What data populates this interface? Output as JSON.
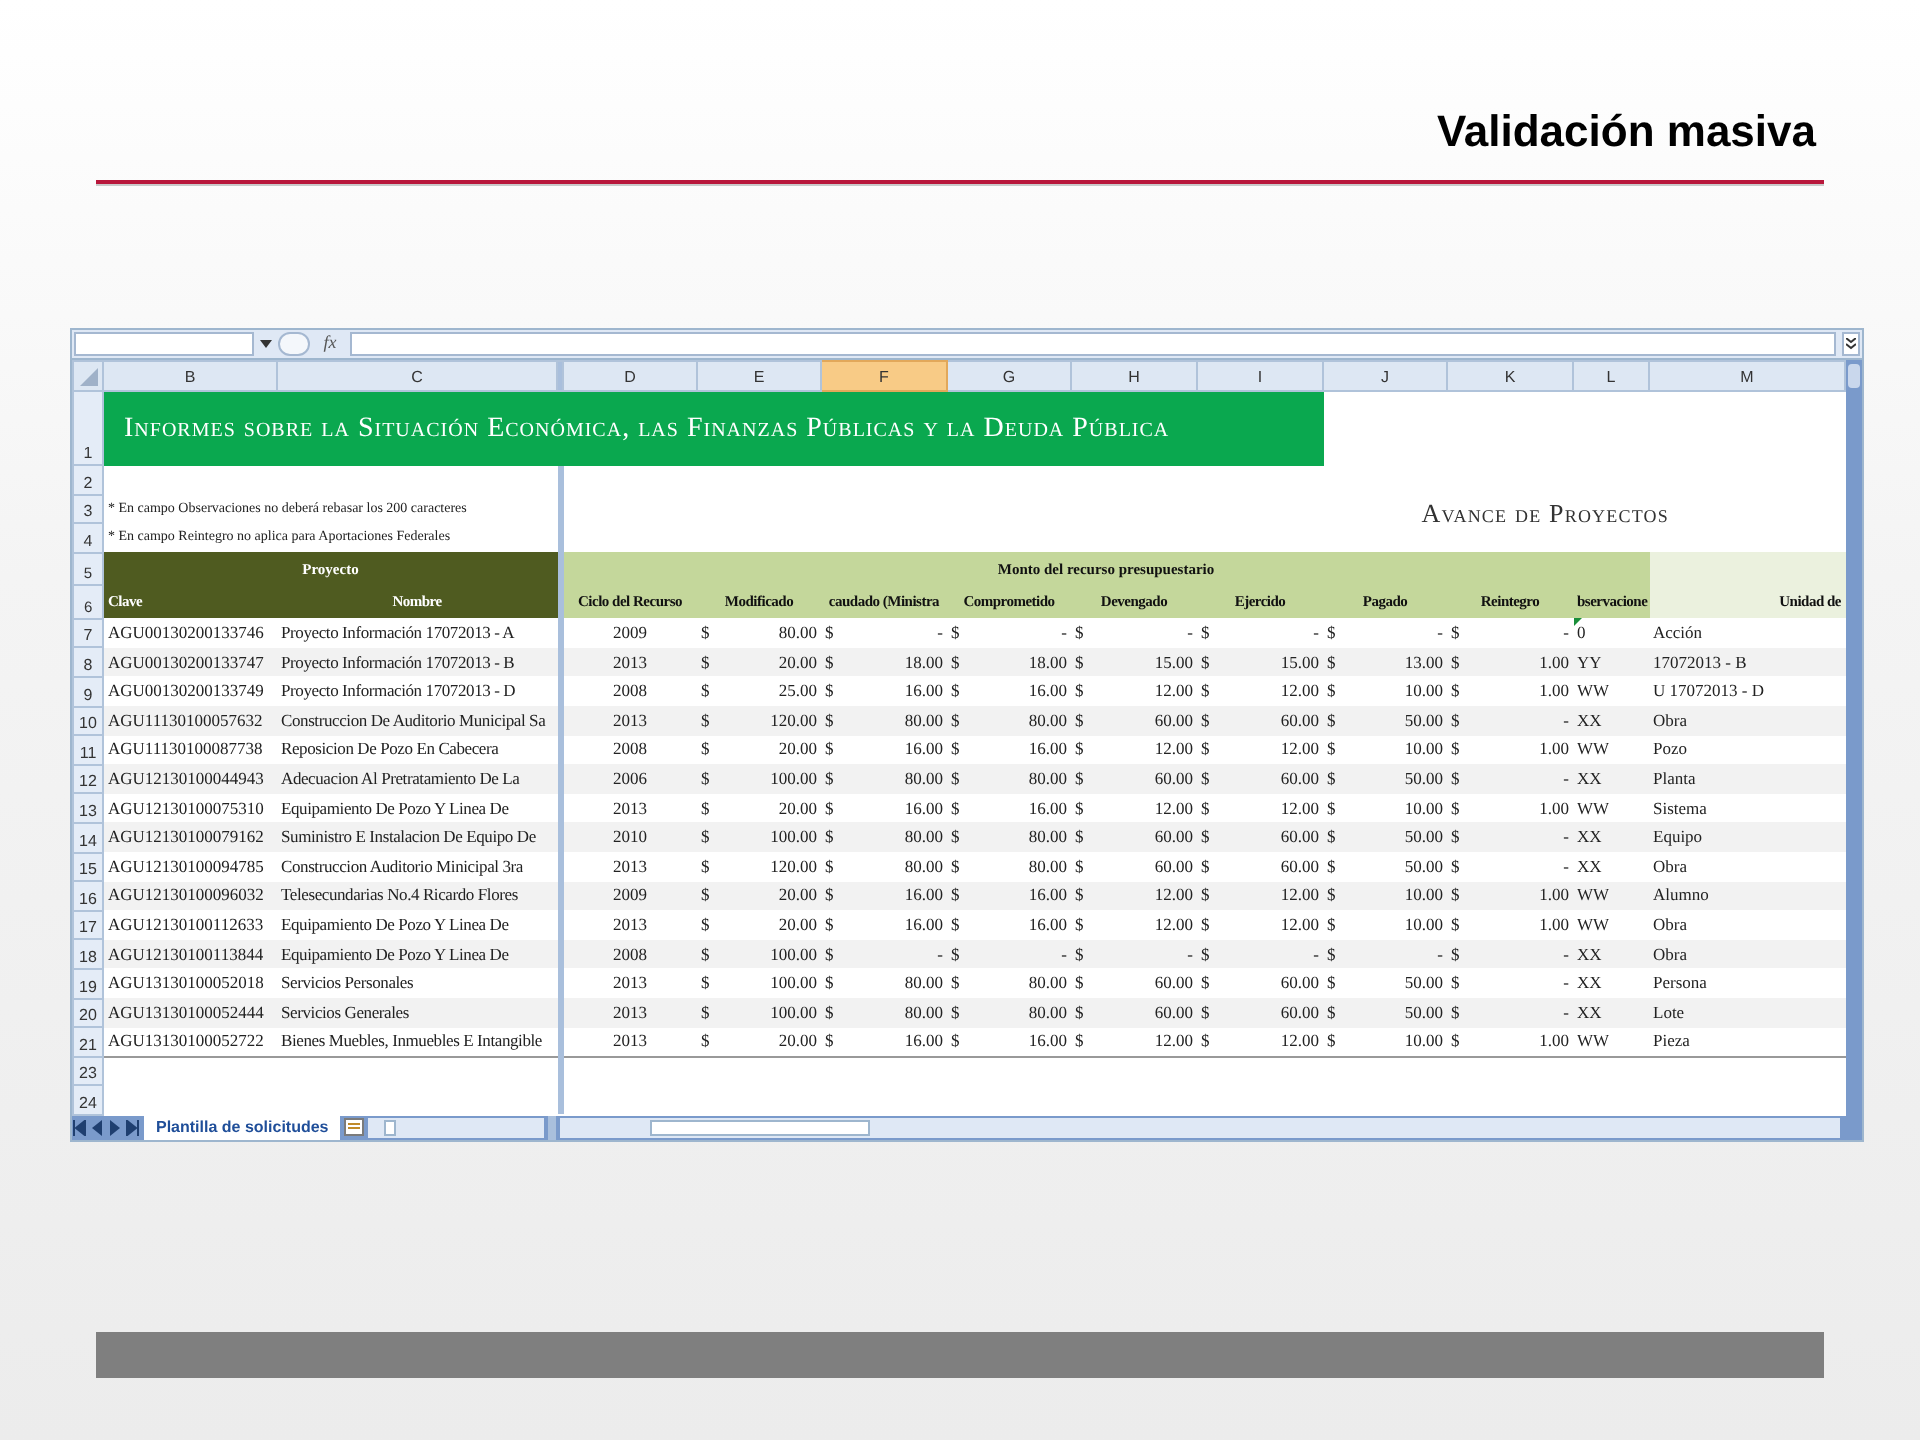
{
  "slide": {
    "title": "Validación masiva"
  },
  "spreadsheet": {
    "formula_bar": {
      "function_label": "fx"
    },
    "column_headers": [
      {
        "label": "B",
        "selected": false
      },
      {
        "label": "C",
        "selected": false
      },
      {
        "label": "D",
        "selected": false
      },
      {
        "label": "E",
        "selected": false
      },
      {
        "label": "F",
        "selected": true
      },
      {
        "label": "G",
        "selected": false
      },
      {
        "label": "H",
        "selected": false
      },
      {
        "label": "I",
        "selected": false
      },
      {
        "label": "J",
        "selected": false
      },
      {
        "label": "K",
        "selected": false
      },
      {
        "label": "L",
        "selected": false
      },
      {
        "label": "M",
        "selected": false
      }
    ],
    "row_numbers": [
      "1",
      "2",
      "3",
      "4",
      "5",
      "6",
      "7",
      "8",
      "9",
      "10",
      "11",
      "12",
      "13",
      "14",
      "15",
      "16",
      "17",
      "18",
      "19",
      "20",
      "21",
      "23",
      "24"
    ],
    "banner": "Informes sobre la Situación Económica, las Finanzas Públicas y la Deuda Pública",
    "subtitle": "Avance de Proyectos",
    "notes": [
      "* En campo Observaciones no deberá rebasar los 200 caracteres",
      "* En campo Reintegro no aplica para Aportaciones Federales"
    ],
    "column_groups": [
      {
        "kind": "project",
        "label": "Proyecto",
        "columns": [
          "Clave",
          "Nombre"
        ]
      },
      {
        "kind": "budget",
        "label": "Monto del recurso presupuestario",
        "columns": [
          "Ciclo del Recurso",
          "Modificado",
          "caudado (Ministra",
          "Comprometido",
          "Devengado",
          "Ejercido",
          "Pagado",
          "Reintegro",
          "bservacione"
        ]
      },
      {
        "kind": "extra",
        "columns": [
          "Unidad de"
        ]
      }
    ],
    "rows": [
      {
        "clave": "AGU00130200133746",
        "nombre": "Proyecto Información 17072013 - A",
        "ciclo": "2009",
        "amounts": [
          [
            "$",
            "80.00"
          ],
          [
            "$",
            "-"
          ],
          [
            "$",
            "-"
          ],
          [
            "$",
            "-"
          ],
          [
            "$",
            "-"
          ],
          [
            "$",
            "-"
          ],
          [
            "$",
            "-"
          ]
        ],
        "observaciones": "0",
        "unidad": "Acción",
        "flagged": true
      },
      {
        "clave": "AGU00130200133747",
        "nombre": "Proyecto Información 17072013 - B",
        "ciclo": "2013",
        "amounts": [
          [
            "$",
            "20.00"
          ],
          [
            "$",
            "18.00"
          ],
          [
            "$",
            "18.00"
          ],
          [
            "$",
            "15.00"
          ],
          [
            "$",
            "15.00"
          ],
          [
            "$",
            "13.00"
          ],
          [
            "$",
            "1.00"
          ]
        ],
        "observaciones": "YY",
        "unidad": "17072013 - B",
        "flagged": false
      },
      {
        "clave": "AGU00130200133749",
        "nombre": "Proyecto Información 17072013 - D",
        "ciclo": "2008",
        "amounts": [
          [
            "$",
            "25.00"
          ],
          [
            "$",
            "16.00"
          ],
          [
            "$",
            "16.00"
          ],
          [
            "$",
            "12.00"
          ],
          [
            "$",
            "12.00"
          ],
          [
            "$",
            "10.00"
          ],
          [
            "$",
            "1.00"
          ]
        ],
        "observaciones": "WW",
        "unidad": "U 17072013 - D",
        "flagged": false
      },
      {
        "clave": "AGU11130100057632",
        "nombre": "Construccion De Auditorio Municipal Sa",
        "ciclo": "2013",
        "amounts": [
          [
            "$",
            "120.00"
          ],
          [
            "$",
            "80.00"
          ],
          [
            "$",
            "80.00"
          ],
          [
            "$",
            "60.00"
          ],
          [
            "$",
            "60.00"
          ],
          [
            "$",
            "50.00"
          ],
          [
            "$",
            "-"
          ]
        ],
        "observaciones": "XX",
        "unidad": "Obra",
        "flagged": false
      },
      {
        "clave": "AGU11130100087738",
        "nombre": "Reposicion De Pozo En Cabecera",
        "ciclo": "2008",
        "amounts": [
          [
            "$",
            "20.00"
          ],
          [
            "$",
            "16.00"
          ],
          [
            "$",
            "16.00"
          ],
          [
            "$",
            "12.00"
          ],
          [
            "$",
            "12.00"
          ],
          [
            "$",
            "10.00"
          ],
          [
            "$",
            "1.00"
          ]
        ],
        "observaciones": "WW",
        "unidad": "Pozo",
        "flagged": false
      },
      {
        "clave": "AGU12130100044943",
        "nombre": "Adecuacion Al Pretratamiento De La",
        "ciclo": "2006",
        "amounts": [
          [
            "$",
            "100.00"
          ],
          [
            "$",
            "80.00"
          ],
          [
            "$",
            "80.00"
          ],
          [
            "$",
            "60.00"
          ],
          [
            "$",
            "60.00"
          ],
          [
            "$",
            "50.00"
          ],
          [
            "$",
            "-"
          ]
        ],
        "observaciones": "XX",
        "unidad": "Planta",
        "flagged": false
      },
      {
        "clave": "AGU12130100075310",
        "nombre": "Equipamiento De Pozo Y Linea De",
        "ciclo": "2013",
        "amounts": [
          [
            "$",
            "20.00"
          ],
          [
            "$",
            "16.00"
          ],
          [
            "$",
            "16.00"
          ],
          [
            "$",
            "12.00"
          ],
          [
            "$",
            "12.00"
          ],
          [
            "$",
            "10.00"
          ],
          [
            "$",
            "1.00"
          ]
        ],
        "observaciones": "WW",
        "unidad": "Sistema",
        "flagged": false
      },
      {
        "clave": "AGU12130100079162",
        "nombre": "Suministro E Instalacion De Equipo De",
        "ciclo": "2010",
        "amounts": [
          [
            "$",
            "100.00"
          ],
          [
            "$",
            "80.00"
          ],
          [
            "$",
            "80.00"
          ],
          [
            "$",
            "60.00"
          ],
          [
            "$",
            "60.00"
          ],
          [
            "$",
            "50.00"
          ],
          [
            "$",
            "-"
          ]
        ],
        "observaciones": "XX",
        "unidad": "Equipo",
        "flagged": false
      },
      {
        "clave": "AGU12130100094785",
        "nombre": "Construccion Auditorio Minicipal 3ra",
        "ciclo": "2013",
        "amounts": [
          [
            "$",
            "120.00"
          ],
          [
            "$",
            "80.00"
          ],
          [
            "$",
            "80.00"
          ],
          [
            "$",
            "60.00"
          ],
          [
            "$",
            "60.00"
          ],
          [
            "$",
            "50.00"
          ],
          [
            "$",
            "-"
          ]
        ],
        "observaciones": "XX",
        "unidad": "Obra",
        "flagged": false
      },
      {
        "clave": "AGU12130100096032",
        "nombre": "Telesecundarias No.4 Ricardo Flores",
        "ciclo": "2009",
        "amounts": [
          [
            "$",
            "20.00"
          ],
          [
            "$",
            "16.00"
          ],
          [
            "$",
            "16.00"
          ],
          [
            "$",
            "12.00"
          ],
          [
            "$",
            "12.00"
          ],
          [
            "$",
            "10.00"
          ],
          [
            "$",
            "1.00"
          ]
        ],
        "observaciones": "WW",
        "unidad": "Alumno",
        "flagged": false
      },
      {
        "clave": "AGU12130100112633",
        "nombre": "Equipamiento De Pozo Y Linea De",
        "ciclo": "2013",
        "amounts": [
          [
            "$",
            "20.00"
          ],
          [
            "$",
            "16.00"
          ],
          [
            "$",
            "16.00"
          ],
          [
            "$",
            "12.00"
          ],
          [
            "$",
            "12.00"
          ],
          [
            "$",
            "10.00"
          ],
          [
            "$",
            "1.00"
          ]
        ],
        "observaciones": "WW",
        "unidad": "Obra",
        "flagged": false
      },
      {
        "clave": "AGU12130100113844",
        "nombre": "Equipamiento De Pozo Y Linea De",
        "ciclo": "2008",
        "amounts": [
          [
            "$",
            "100.00"
          ],
          [
            "$",
            "-"
          ],
          [
            "$",
            "-"
          ],
          [
            "$",
            "-"
          ],
          [
            "$",
            "-"
          ],
          [
            "$",
            "-"
          ],
          [
            "$",
            "-"
          ]
        ],
        "observaciones": "XX",
        "unidad": "Obra",
        "flagged": false
      },
      {
        "clave": "AGU13130100052018",
        "nombre": "Servicios Personales",
        "ciclo": "2013",
        "amounts": [
          [
            "$",
            "100.00"
          ],
          [
            "$",
            "80.00"
          ],
          [
            "$",
            "80.00"
          ],
          [
            "$",
            "60.00"
          ],
          [
            "$",
            "60.00"
          ],
          [
            "$",
            "50.00"
          ],
          [
            "$",
            "-"
          ]
        ],
        "observaciones": "XX",
        "unidad": "Persona",
        "flagged": false
      },
      {
        "clave": "AGU13130100052444",
        "nombre": "Servicios Generales",
        "ciclo": "2013",
        "amounts": [
          [
            "$",
            "100.00"
          ],
          [
            "$",
            "80.00"
          ],
          [
            "$",
            "80.00"
          ],
          [
            "$",
            "60.00"
          ],
          [
            "$",
            "60.00"
          ],
          [
            "$",
            "50.00"
          ],
          [
            "$",
            "-"
          ]
        ],
        "observaciones": "XX",
        "unidad": "Lote",
        "flagged": false
      },
      {
        "clave": "AGU13130100052722",
        "nombre": "Bienes Muebles, Inmuebles E Intangible",
        "ciclo": "2013",
        "amounts": [
          [
            "$",
            "20.00"
          ],
          [
            "$",
            "16.00"
          ],
          [
            "$",
            "16.00"
          ],
          [
            "$",
            "12.00"
          ],
          [
            "$",
            "12.00"
          ],
          [
            "$",
            "10.00"
          ],
          [
            "$",
            "1.00"
          ]
        ],
        "observaciones": "WW",
        "unidad": "Pieza",
        "flagged": false
      }
    ],
    "sheet_tabs": [
      {
        "label": "Plantilla de solicitudes",
        "selected": true
      }
    ]
  }
}
